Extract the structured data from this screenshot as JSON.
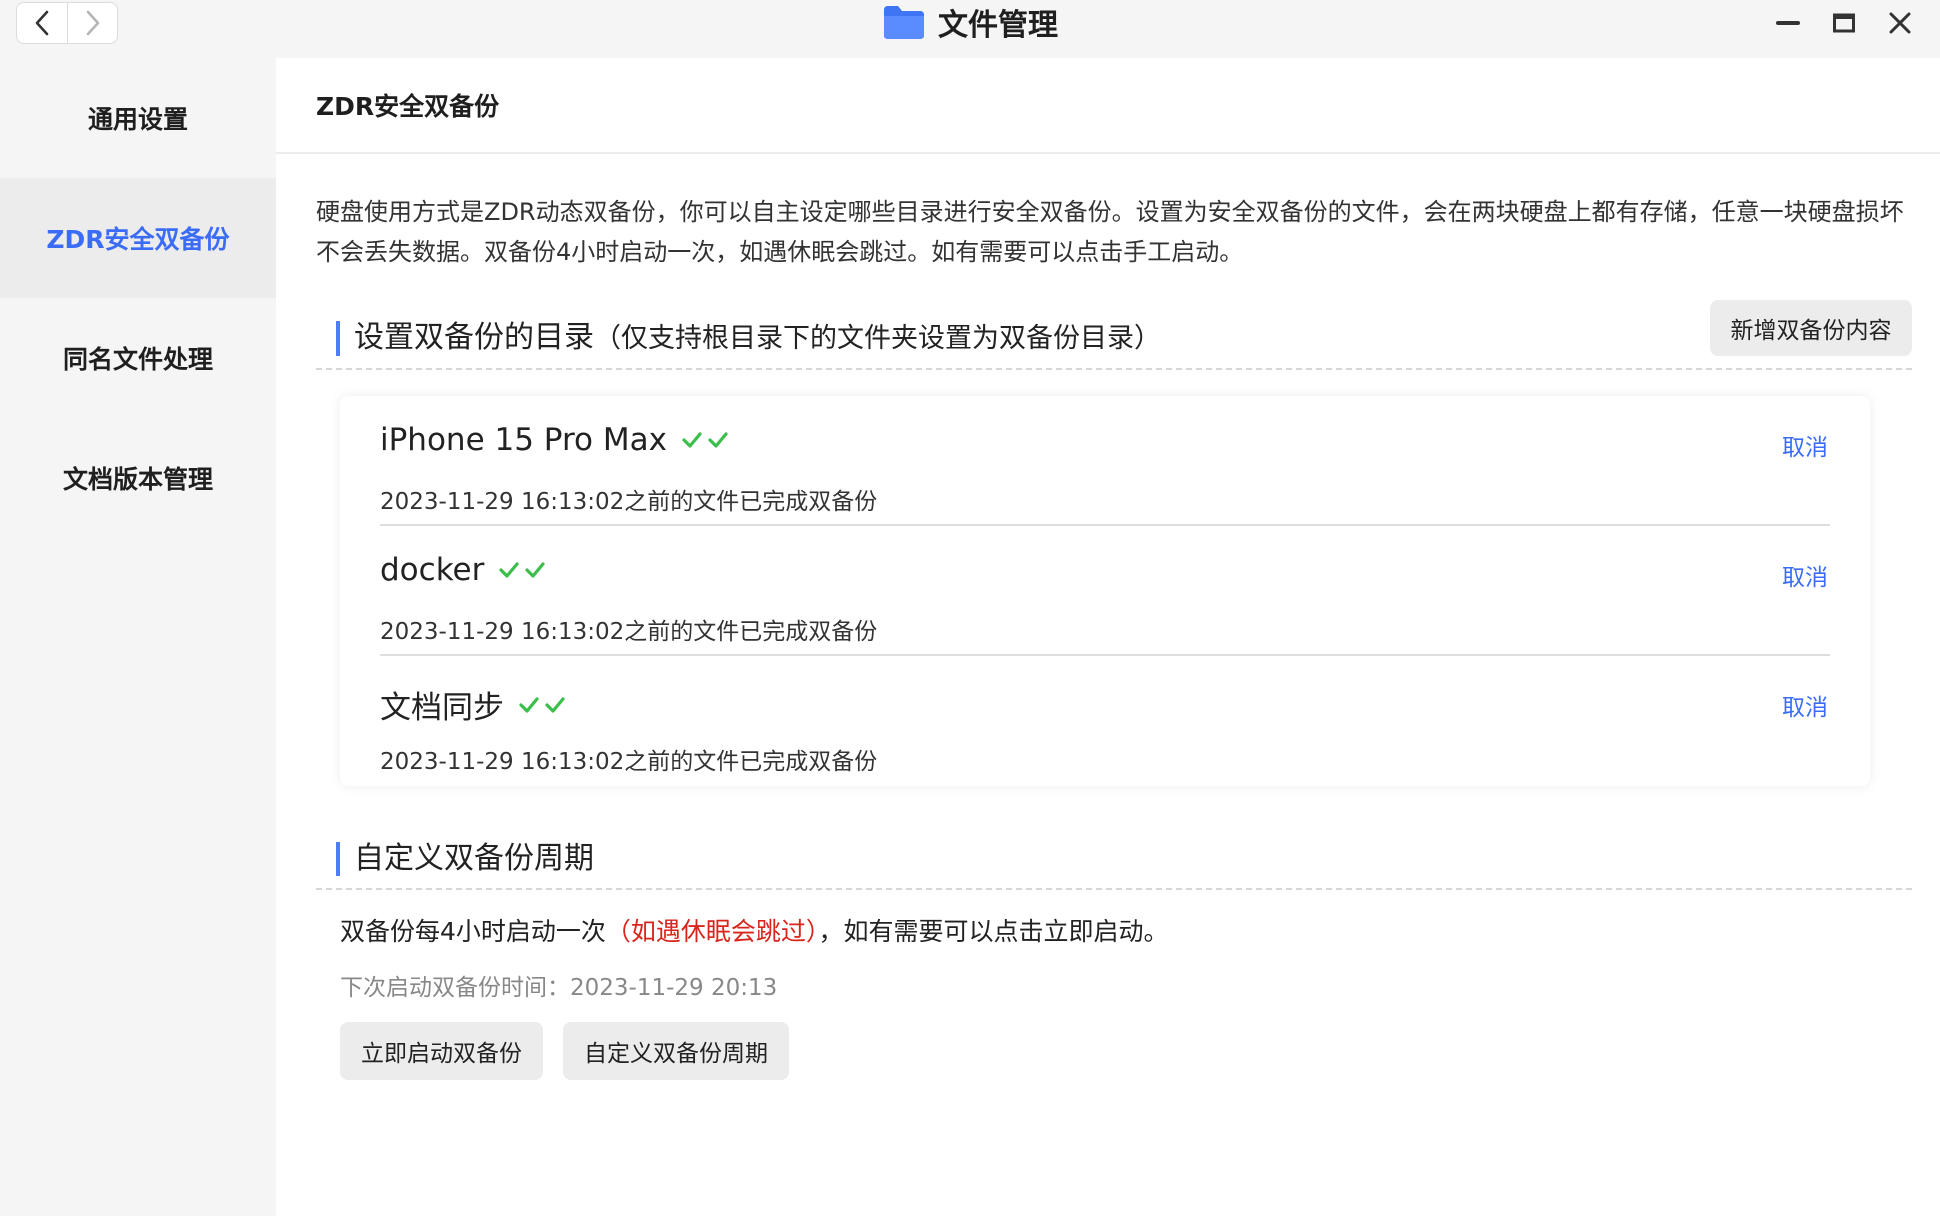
{
  "window": {
    "title": "文件管理",
    "icon": "folder-icon",
    "controls": [
      "minimize-icon",
      "maximize-icon",
      "close-icon"
    ]
  },
  "sidebar": {
    "items": [
      {
        "label": "通用设置",
        "active": false
      },
      {
        "label": "ZDR安全双备份",
        "active": true
      },
      {
        "label": "同名文件处理",
        "active": false
      },
      {
        "label": "文档版本管理",
        "active": false
      }
    ]
  },
  "main": {
    "header": "ZDR安全双备份",
    "description": "硬盘使用方式是ZDR动态双备份，你可以自主设定哪些目录进行安全双备份。设置为安全双备份的文件，会在两块硬盘上都有存储，任意一块硬盘损坏不会丢失数据。双备份4小时启动一次，如遇休眠会跳过。如有需要可以点击手工启动。",
    "dirs_section": {
      "title": "设置双备份的目录",
      "note": "（仅支持根目录下的文件夹设置为双备份目录）",
      "add_button": "新增双备份内容"
    },
    "dirs": [
      {
        "name": "iPhone 15 Pro Max",
        "status": "2023-11-29 16:13:02之前的文件已完成双备份",
        "action": "取消"
      },
      {
        "name": "docker",
        "status": "2023-11-29 16:13:02之前的文件已完成双备份",
        "action": "取消"
      },
      {
        "name": "文档同步",
        "status": "2023-11-29 16:13:02之前的文件已完成双备份",
        "action": "取消"
      }
    ],
    "period_section": {
      "title": "自定义双备份周期",
      "line_prefix": "双备份每4小时启动一次",
      "line_highlight": "（如遇休眠会跳过）",
      "line_suffix": "，如有需要可以点击立即启动。",
      "next_time": "下次启动双备份时间：2023-11-29 20:13",
      "start_button": "立即启动双备份",
      "custom_button": "自定义双备份周期"
    }
  },
  "colors": {
    "accent": "#3b6cf6",
    "check": "#3bbf4a",
    "warning": "#d9261c",
    "sidebar_bg": "#f5f5f5"
  }
}
